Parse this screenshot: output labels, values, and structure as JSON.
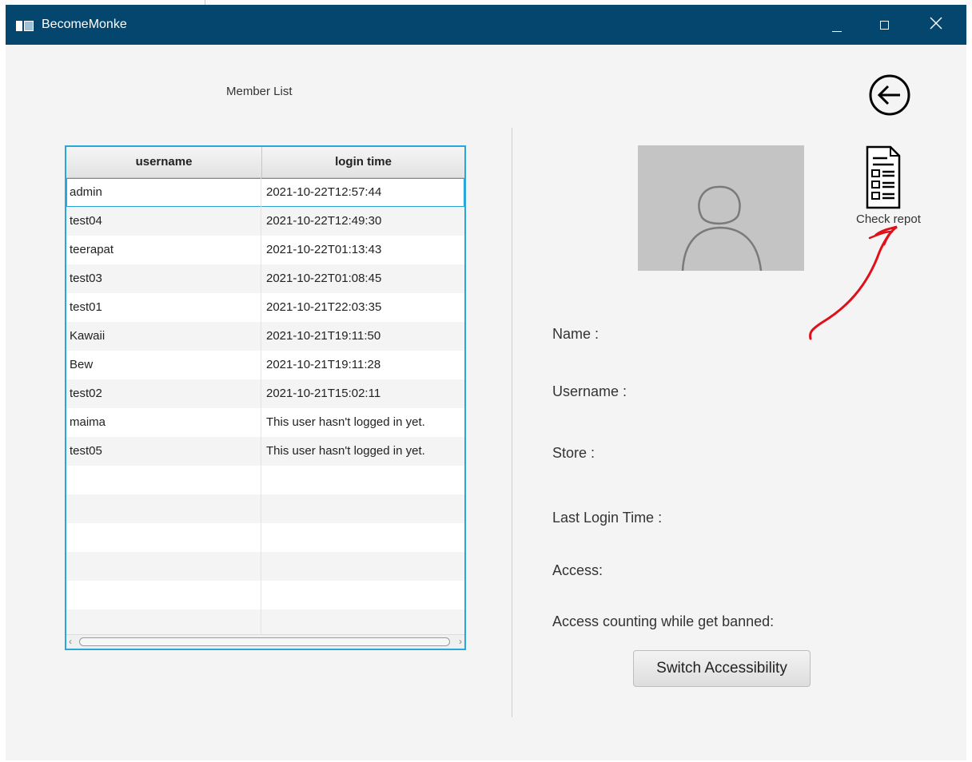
{
  "window": {
    "title": "BecomeMonke"
  },
  "member_list": {
    "title": "Member List",
    "columns": [
      "username",
      "login time"
    ],
    "rows": [
      {
        "username": "admin",
        "login_time": "2021-10-22T12:57:44"
      },
      {
        "username": "test04",
        "login_time": "2021-10-22T12:49:30"
      },
      {
        "username": "teerapat",
        "login_time": "2021-10-22T01:13:43"
      },
      {
        "username": "test03",
        "login_time": "2021-10-22T01:08:45"
      },
      {
        "username": "test01",
        "login_time": "2021-10-21T22:03:35"
      },
      {
        "username": "Kawaii",
        "login_time": "2021-10-21T19:11:50"
      },
      {
        "username": "Bew",
        "login_time": "2021-10-21T19:11:28"
      },
      {
        "username": "test02",
        "login_time": "2021-10-21T15:02:11"
      },
      {
        "username": "maima",
        "login_time": "This user hasn't logged in yet."
      },
      {
        "username": "test05",
        "login_time": "This user hasn't logged in yet."
      }
    ]
  },
  "details": {
    "name_label": "Name :",
    "username_label": "Username :",
    "store_label": "Store :",
    "last_login_label": "Last Login Time :",
    "access_label": "Access:",
    "access_count_label": "Access counting while get banned:",
    "switch_button": "Switch Accessibility"
  },
  "actions": {
    "check_report_label": "Check repot"
  },
  "icons": {
    "back": "back-arrow-icon",
    "report": "report-document-icon",
    "avatar": "user-avatar-icon"
  },
  "colors": {
    "titlebar": "#04466e",
    "table_focus": "#29a7d8",
    "annotation": "#e0101a"
  }
}
